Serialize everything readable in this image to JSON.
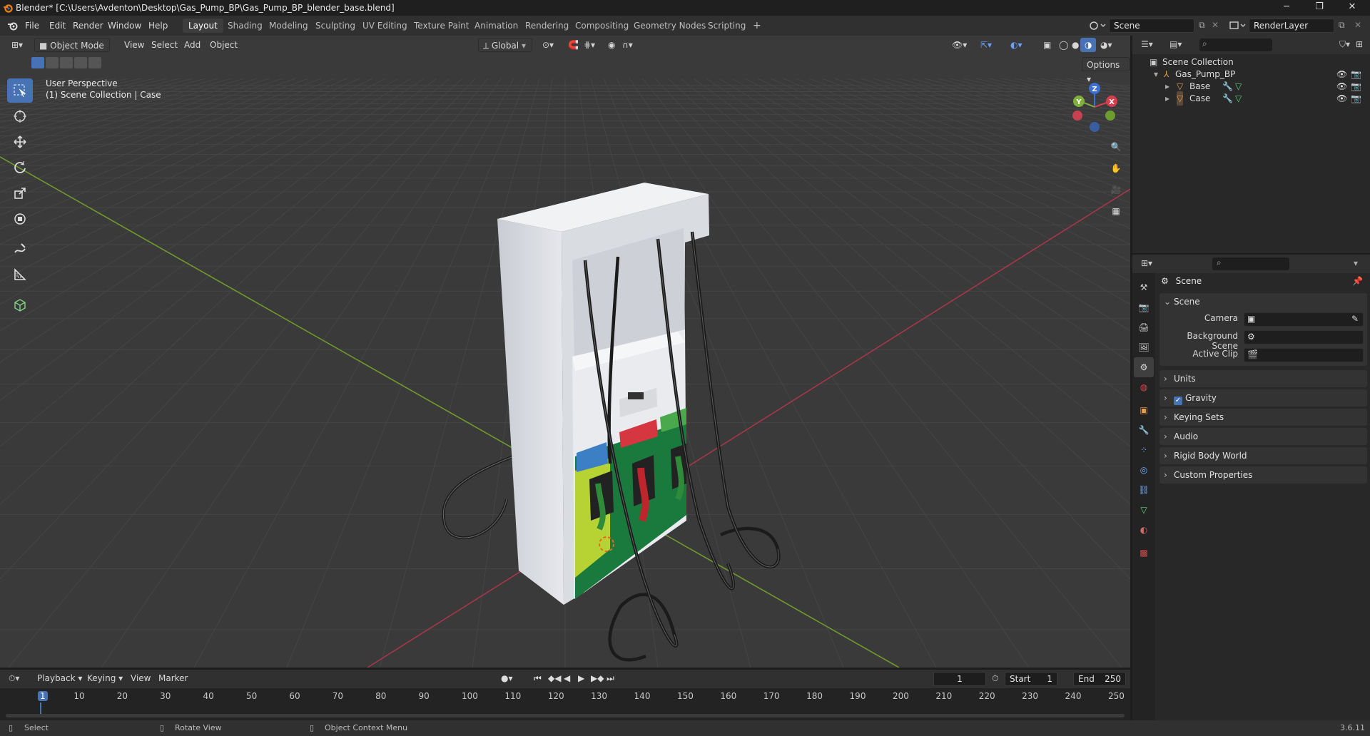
{
  "window": {
    "title": "Blender* [C:\\Users\\Avdenton\\Desktop\\Gas_Pump_BP\\Gas_Pump_BP_blender_base.blend]",
    "minimize": "─",
    "restore": "❐",
    "close": "✕"
  },
  "menus": [
    "File",
    "Edit",
    "Render",
    "Window",
    "Help"
  ],
  "workspaces": [
    "Layout",
    "Shading",
    "Modeling",
    "Sculpting",
    "UV Editing",
    "Texture Paint",
    "Animation",
    "Rendering",
    "Compositing",
    "Geometry Nodes",
    "Scripting"
  ],
  "workspace_add": "+",
  "active_workspace": "Layout",
  "scene_field": "Scene",
  "renderlayer_field": "RenderLayer",
  "viewport": {
    "mode": "Object Mode",
    "menus": [
      "View",
      "Select",
      "Add",
      "Object"
    ],
    "transform_orientation": "Global",
    "options_label": "Options",
    "overlay_text_1": "User Perspective",
    "overlay_text_2": "(1) Scene Collection | Case",
    "gizmo_axes": {
      "x": "X",
      "y": "Y",
      "z": "Z"
    },
    "colors": {
      "x_axis": "#a8364a",
      "y_axis": "#6e9a2b",
      "grid": "#434343",
      "active_tool": "#4772b3"
    }
  },
  "outliner": {
    "root": "Scene Collection",
    "items": [
      {
        "name": "Gas_Pump_BP",
        "icon": "empty-icon"
      },
      {
        "name": "Base",
        "icon": "mesh-icon"
      },
      {
        "name": "Case",
        "icon": "mesh-icon"
      }
    ]
  },
  "properties": {
    "context": "Scene",
    "panel_title": "Scene",
    "camera_label": "Camera",
    "background_scene_label": "Background Scene",
    "active_clip_label": "Active Clip",
    "collapsed_panels": [
      "Units",
      "Gravity",
      "Keying Sets",
      "Audio",
      "Rigid Body World",
      "Custom Properties"
    ],
    "gravity_checked": true
  },
  "timeline": {
    "menus": [
      "Playback",
      "Keying",
      "View",
      "Marker"
    ],
    "current_frame": "1",
    "start_label": "Start",
    "start_value": "1",
    "end_label": "End",
    "end_value": "250",
    "ticks": [
      "1",
      "10",
      "20",
      "30",
      "40",
      "50",
      "60",
      "70",
      "80",
      "90",
      "100",
      "110",
      "120",
      "130",
      "140",
      "150",
      "160",
      "170",
      "180",
      "190",
      "200",
      "210",
      "220",
      "230",
      "240",
      "250"
    ]
  },
  "statusbar": {
    "select": "Select",
    "rotate": "Rotate View",
    "context_menu": "Object Context Menu",
    "version": "3.6.11"
  }
}
